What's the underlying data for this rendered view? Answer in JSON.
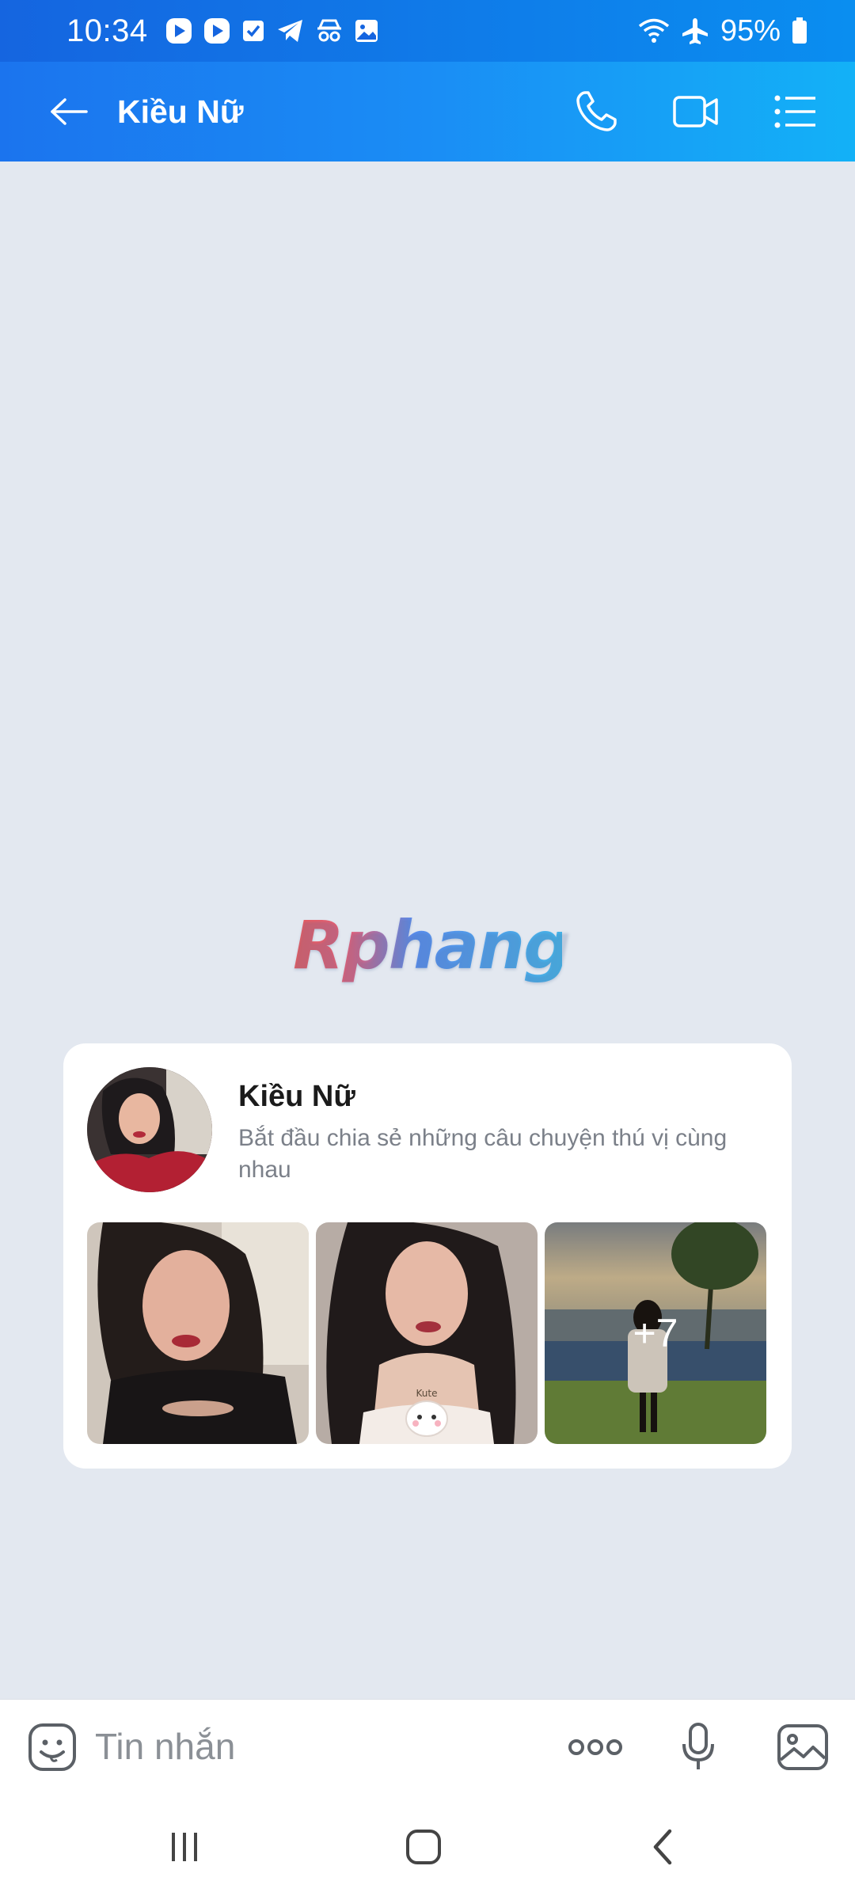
{
  "status_bar": {
    "time": "10:34",
    "battery": "95%",
    "notification_icons": [
      "play-app-icon",
      "play-app-icon",
      "checkbox-icon",
      "telegram-icon",
      "incognito-icon",
      "image-icon"
    ],
    "system_icons": [
      "wifi-icon",
      "airplane-mode-icon",
      "battery-icon"
    ]
  },
  "header": {
    "title": "Kiều Nữ",
    "back_icon": "arrow-left-icon",
    "actions": [
      "phone-call-icon",
      "video-call-icon",
      "menu-list-icon"
    ],
    "gradient": [
      "#1b74ee",
      "#13b1f7"
    ]
  },
  "watermark": {
    "text": "Rphang"
  },
  "profile_card": {
    "name": "Kiều Nữ",
    "description": "Bắt đầu chia sẻ những câu chuyện thú vị cùng nhau",
    "more_photos": "+7"
  },
  "input_bar": {
    "placeholder": "Tin nhắn",
    "icons": [
      "sticker-emoji-icon",
      "more-options-icon",
      "microphone-icon",
      "gallery-icon"
    ]
  },
  "nav_bar": {
    "icons": [
      "recent-apps-icon",
      "home-icon",
      "back-icon"
    ]
  },
  "colors": {
    "accent": "#1a8df5",
    "chat_background": "#e3e8f0",
    "text_muted": "#7b8089"
  }
}
